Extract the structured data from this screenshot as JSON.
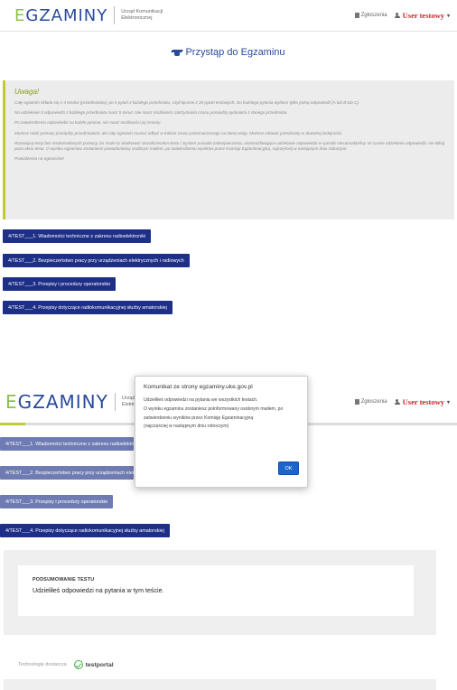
{
  "header": {
    "logo_first": "E",
    "logo_rest": "GZAMINY",
    "logo_subtitle": "Urząd Komunikacji Elektronicznej",
    "reports_link": "Zgłoszenia",
    "user_name": "User testowy",
    "caret": "▾"
  },
  "start": {
    "title": "Przystąp do Egzaminu"
  },
  "warning": {
    "title": "Uwaga!",
    "paragraphs": [
      "Cały egzamin składa się z 4 testów (przedmiotów), po 5 pytań z każdego przedmiotu, czyli łącznie z 20 pytań testowych. Do każdego pytania wybierz tylko jedną odpowiedź (A lub B lub C).",
      "Na udzielenie 5 odpowiedzi z każdego przedmiotu masz 5 minut. Nie masz możliwości zatrzymania czasu pomiędzy pytaniami z danego przedmiotu.",
      "Po zatwierdzeniu odpowiedzi na każde pytanie, nie masz możliwości jej zmiany.",
      "Możesz robić przerwy pomiędzy przedmiotami, ale cały egzamin musisz odbyć w trakcie czasu przeznaczonego na daną sesję. Możesz zdawać przedmioty w dowolnej kolejności.",
      "Rozwiązuj testy bez niedozwolonych pomocy, bo może to skutkować niezaliczeniem testu / System posiada zabezpieczenia, uniemożliwiające udzielanie odpowiedzi w sposób niesamodzielny. W czasie udzielania odpowiedzi, nie klikaj poza okno testu. O wyniku egzaminu zostaniesz powiadomiony osobnym mailem, po zatwierdzeniu wyników przez Komisję Egzaminacyjną, najczęściej w następnym dniu roboczym.",
      "Powodzenia na egzaminie!"
    ]
  },
  "tests": [
    "4/TEST___1. Wiadomości techniczne z zakresu radioelektroniki",
    "4/TEST___2. Bezpieczeństwo pracy przy urządzeniach elektrycznych i radiowych",
    "4/TEST___3. Przepisy i procedury operatorskie",
    "4/TEST___4. Przepisy dotyczące radiokomunikacyjnej służby amatorskiej"
  ],
  "dialog": {
    "title": "Komunikat ze strony egzaminy.uke.gov.pl",
    "lines": [
      "Udzieliłeś odpowiedzi na pytania we wszystkich testach.",
      "O wyniku egzaminu zostaniesz poinformowany osobnym mailem, po",
      "zatwierdzeniu wyników przez Komisję Egzaminacyjną",
      "(najczęściej w następnym dniu roboczym)"
    ],
    "ok_label": "OK"
  },
  "summary": {
    "label": "PODSUMOWANIE TESTU",
    "text": "Udzieliłeś odpowiedzi na pytania w tym teście."
  },
  "footer": {
    "label": "Technologię dostarcza",
    "brand": "testportal"
  },
  "colors": {
    "primary": "#1e2f87",
    "primary_dim": "#6f7cb3",
    "logo_blue": "#2a4b9b",
    "logo_green": "#8bc34a",
    "accent": "#c0ca33",
    "user_red": "#c62828",
    "ok_button": "#1b66c9"
  },
  "icons": [
    "graduation-cap-icon",
    "document-icon",
    "user-icon",
    "testportal-check-icon"
  ]
}
